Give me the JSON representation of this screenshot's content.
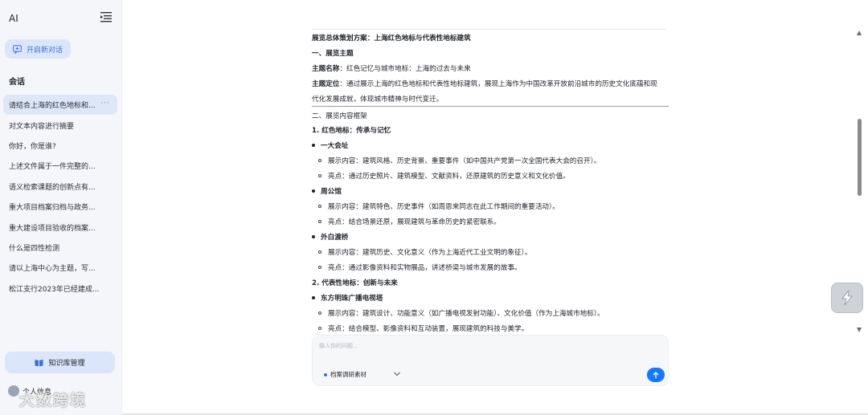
{
  "sidebar": {
    "app_title": "AI",
    "new_chat_label": "开启新对话",
    "section_title": "会话",
    "conversations": [
      "请结合上海的红色地标和...",
      "对文本内容进行摘要",
      "你好，你是谁?",
      "上述文件属于一件完整的...",
      "语义检索课题的创新点有...",
      "重大项目档案归档与政务...",
      "重大建设项目验收的档案...",
      "什么是四性检测",
      "请以上海中心为主题，写...",
      "松江支行2023年已经建成..."
    ],
    "active_more": "···",
    "kb_label": "知识库管理",
    "user_label": "个人信息",
    "watermark": "大数跨境"
  },
  "doc": {
    "title": "展览总体策划方案：上海红色地标与代表性地标建筑",
    "s1": "一、展览主题",
    "theme_name_label": "主题名称",
    "theme_name_value": "：红色记忆与城市地标：上海的过去与未来",
    "theme_pos_label": "主题定位",
    "theme_pos_value_1": "：通过展示上海的红色地标和代表性地标建筑，展现上海作为中国改革开放前沿城市的历史文化底蕴和现",
    "theme_pos_value_2": "代化发展成就，体现城市精神与时代变迁。",
    "s2": "二、展览内容框架",
    "p1": "1. 红色地标：传承与记忆",
    "b1": "一大会址",
    "b1c1": "展示内容：建筑风格、历史背景、重要事件（如中国共产党第一次全国代表大会的召开）。",
    "b1c2": "亮点：通过历史照片、建筑模型、文献资料，还原建筑的历史意义和文化价值。",
    "b2": "周公馆",
    "b2c1": "展示内容：建筑特色、历史事件（如周恩来同志在此工作期间的重要活动）。",
    "b2c2": "亮点：结合场景还原，展现建筑与革命历史的紧密联系。",
    "b3": "外白渡桥",
    "b3c1": "展示内容：建筑历史、文化意义（作为上海近代工业文明的象征）。",
    "b3c2": "亮点：通过影像资料和实物展品，讲述桥梁与城市发展的故事。",
    "p2": "2. 代表性地标：创新与未来",
    "b4": "东方明珠广播电视塔",
    "b4c1": "展示内容：建筑设计、功能意义（如广播电视发射功能）、文化价值（作为上海城市地标）。",
    "b4c2": "亮点：结合模型、影像资料和互动装置，展现建筑的科技与美学。"
  },
  "input": {
    "placeholder": "输入你的问题...",
    "source_label": "档案调研素材"
  },
  "colors": {
    "accent": "#1677ff",
    "sidebar_bg": "#f4f6fa",
    "button_bg": "#dbe6fb"
  }
}
